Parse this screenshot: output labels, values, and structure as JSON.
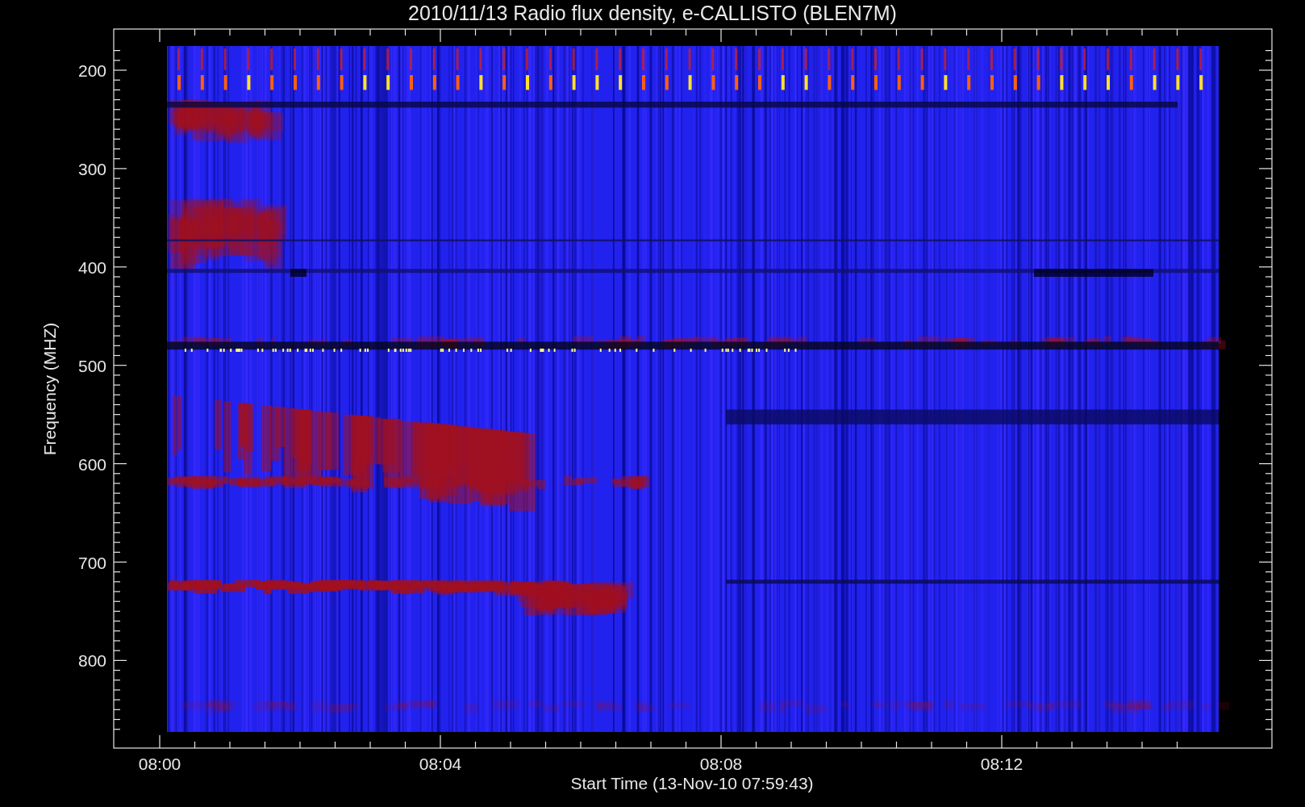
{
  "title": "2010/11/13  Radio flux density, e-CALLISTO (BLEN7M)",
  "ylabel": "Frequency (MHZ)",
  "xlabel": "Start Time (13-Nov-10 07:59:43)",
  "yticks": [
    "200",
    "300",
    "400",
    "500",
    "600",
    "700",
    "800"
  ],
  "xticks": [
    "08:00",
    "08:04",
    "08:08",
    "08:12"
  ]
}
